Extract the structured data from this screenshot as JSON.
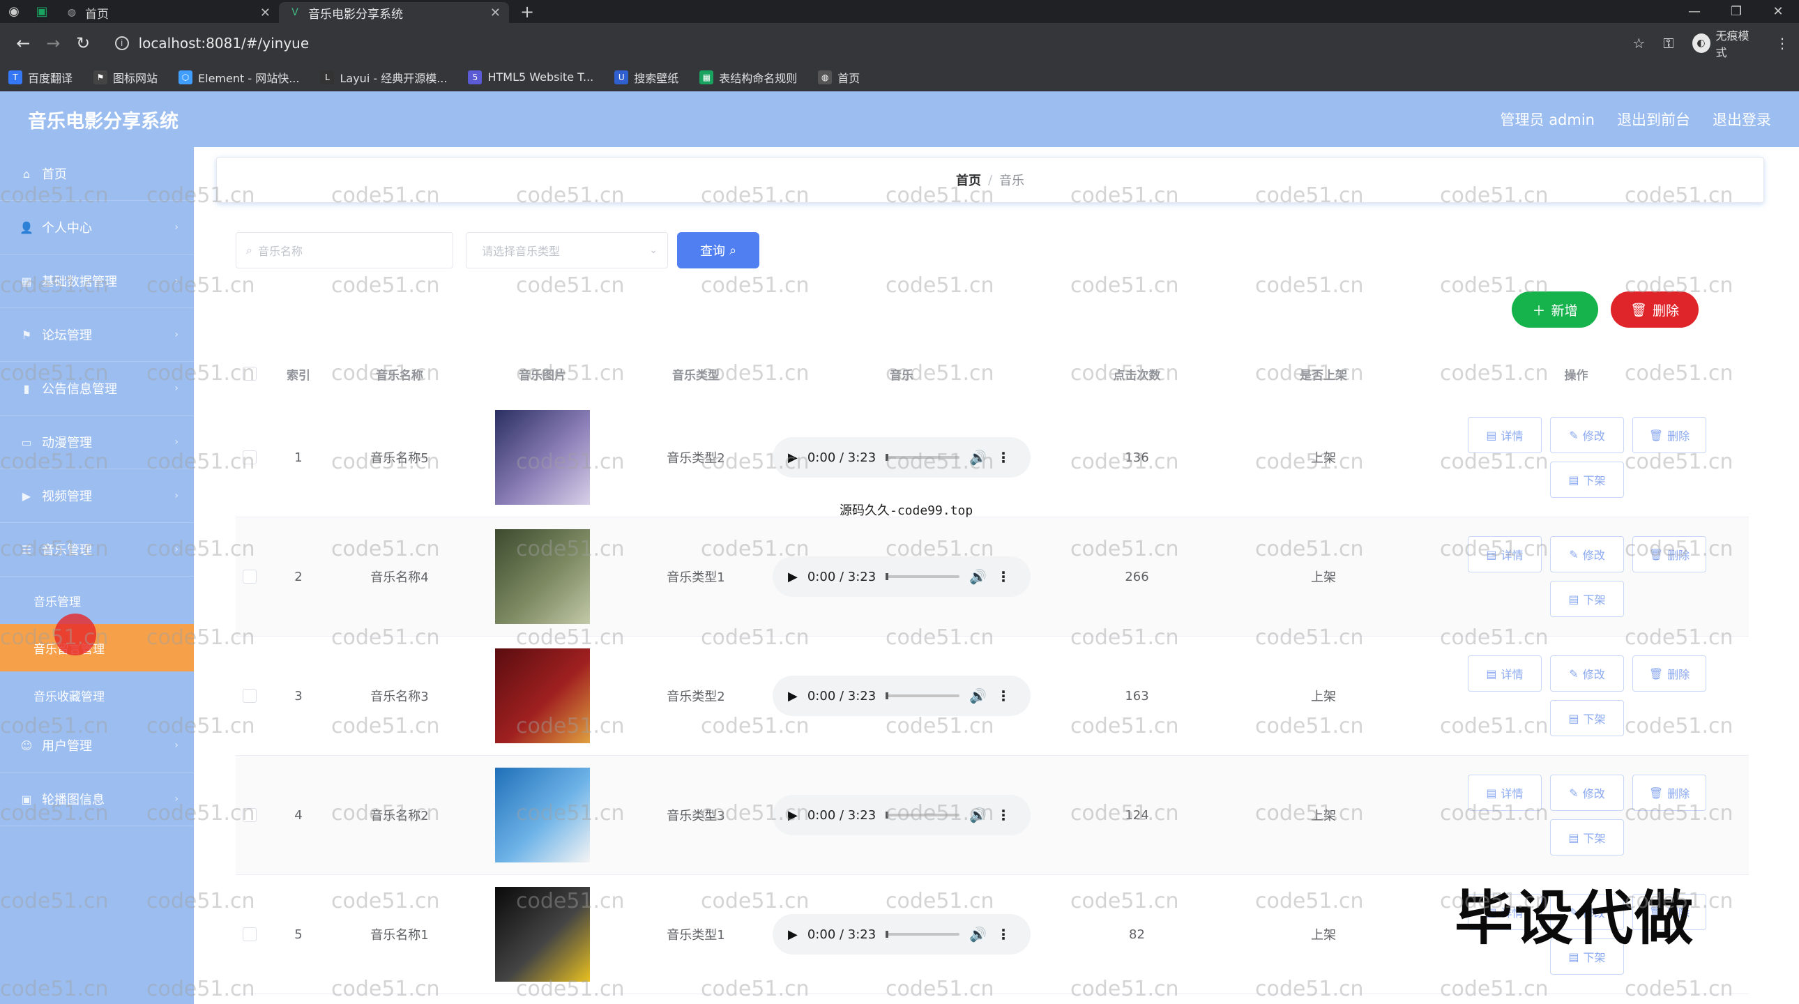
{
  "browser": {
    "tabs": [
      {
        "title": "首页",
        "active": false
      },
      {
        "title": "音乐电影分享系统",
        "active": true
      }
    ],
    "url": "localhost:8081/#/yinyue",
    "incognito_label": "无痕模式",
    "bookmarks": [
      {
        "label": "百度翻译",
        "icon": "translate-icon",
        "color": "#3478f6"
      },
      {
        "label": "图标网站",
        "icon": "flag-icon",
        "color": "#444444"
      },
      {
        "label": "Element - 网站快...",
        "icon": "element-icon",
        "color": "#409eff"
      },
      {
        "label": "Layui - 经典开源模...",
        "icon": "layui-icon",
        "color": "#333333"
      },
      {
        "label": "HTML5 Website T...",
        "icon": "html5-icon",
        "color": "#5b5bd6"
      },
      {
        "label": "搜索壁纸",
        "icon": "wallpaper-icon",
        "color": "#3060d0"
      },
      {
        "label": "表结构命名规则",
        "icon": "sheet-icon",
        "color": "#1aa260"
      },
      {
        "label": "首页",
        "icon": "globe-icon",
        "color": "#555555"
      }
    ]
  },
  "app": {
    "title": "音乐电影分享系统",
    "header_links": [
      "管理员 admin",
      "退出到前台",
      "退出登录"
    ]
  },
  "sidebar": {
    "items": [
      {
        "label": "首页",
        "icon": "home-icon"
      },
      {
        "label": "个人中心",
        "icon": "user-icon"
      },
      {
        "label": "基础数据管理",
        "icon": "grid-icon"
      },
      {
        "label": "论坛管理",
        "icon": "flag-icon"
      },
      {
        "label": "公告信息管理",
        "icon": "bar-chart-icon"
      },
      {
        "label": "动漫管理",
        "icon": "folder-icon"
      },
      {
        "label": "视频管理",
        "icon": "video-icon"
      },
      {
        "label": "音乐管理",
        "icon": "list-icon"
      }
    ],
    "sub_items": [
      {
        "label": "音乐管理",
        "active": false
      },
      {
        "label": "音乐留言管理",
        "active": true
      },
      {
        "label": "音乐收藏管理",
        "active": false
      }
    ],
    "after_items": [
      {
        "label": "用户管理",
        "icon": "user-group-icon"
      },
      {
        "label": "轮播图信息",
        "icon": "image-icon"
      }
    ]
  },
  "breadcrumb": {
    "home": "首页",
    "separator": "/",
    "current": "音乐"
  },
  "search": {
    "name_placeholder": "音乐名称",
    "type_placeholder": "请选择音乐类型",
    "query_label": "查询"
  },
  "actions": {
    "add_label": "新增",
    "delete_label": "删除"
  },
  "table": {
    "columns": [
      "索引",
      "音乐名称",
      "音乐图片",
      "音乐类型",
      "音乐",
      "点击次数",
      "是否上架",
      "操作"
    ],
    "op_labels": {
      "detail": "详情",
      "edit": "修改",
      "delete": "删除",
      "offshelf": "下架"
    },
    "rows": [
      {
        "index": "1",
        "name": "音乐名称5",
        "type": "音乐类型2",
        "time": "0:00 / 3:23",
        "clicks": "136",
        "shelf": "上架",
        "thumb": [
          "#2a2f60",
          "#8c7fb8",
          "#d8d0e8"
        ]
      },
      {
        "index": "2",
        "name": "音乐名称4",
        "type": "音乐类型1",
        "time": "0:00 / 3:23",
        "clicks": "266",
        "shelf": "上架",
        "thumb": [
          "#3d4a2e",
          "#7d8a62",
          "#c2c9a8"
        ]
      },
      {
        "index": "3",
        "name": "音乐名称3",
        "type": "音乐类型2",
        "time": "0:00 / 3:23",
        "clicks": "163",
        "shelf": "上架",
        "thumb": [
          "#5a0d10",
          "#a02020",
          "#e0a040"
        ]
      },
      {
        "index": "4",
        "name": "音乐名称2",
        "type": "音乐类型3",
        "time": "0:00 / 3:23",
        "clicks": "124",
        "shelf": "上架",
        "thumb": [
          "#1f6fb8",
          "#6fb4e8",
          "#f4f4f4"
        ]
      },
      {
        "index": "5",
        "name": "音乐名称1",
        "type": "音乐类型1",
        "time": "0:00 / 3:23",
        "clicks": "82",
        "shelf": "上架",
        "thumb": [
          "#0a0a0a",
          "#444444",
          "#e8c020"
        ]
      }
    ]
  },
  "overlays": {
    "source_text": "源码久久-code99.top",
    "big_text": "毕设代做",
    "watermark": "code51.cn"
  }
}
